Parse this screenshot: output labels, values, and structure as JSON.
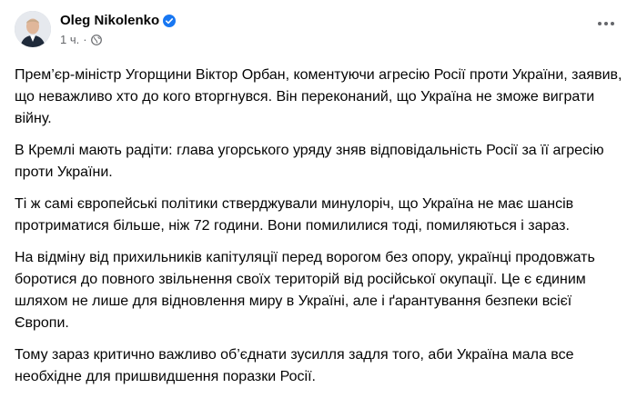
{
  "post": {
    "author": "Oleg Nikolenko",
    "time": "1 ч.",
    "separator": "·",
    "paragraphs": [
      "Прем’єр-міністр Угорщини Віктор Орбан, коментуючи агресію Росії проти України, заявив, що неважливо хто до кого вторгнувся. Він переконаний, що Україна не зможе виграти війну.",
      "В Кремлі мають радіти: глава угорського уряду зняв відповідальність Росії за її агресію проти України.",
      "Ті ж самі європейські політики стверджували минулоріч, що Україна не має шансів протриматися більше, ніж 72 години. Вони помилилися тоді, помиляються і зараз.",
      "На відміну від прихильників капітуляції перед ворогом без опору, українці продовжать боротися до повного звільнення своїх територій від російської окупації. Це є єдиним шляхом не лише для відновлення миру в Україні, але і ґарантування безпеки всієї Європи.",
      "Тому зараз критично важливо об’єднати зусилля задля того, аби Україна мала все необхідне для пришвидшення поразки Росії."
    ]
  },
  "icons": {
    "verified": "verified-badge-icon",
    "audience": "globe-icon",
    "more": "more-options-icon"
  },
  "colors": {
    "verified": "#1877f2",
    "secondary_text": "#65676b",
    "primary_text": "#050505"
  }
}
